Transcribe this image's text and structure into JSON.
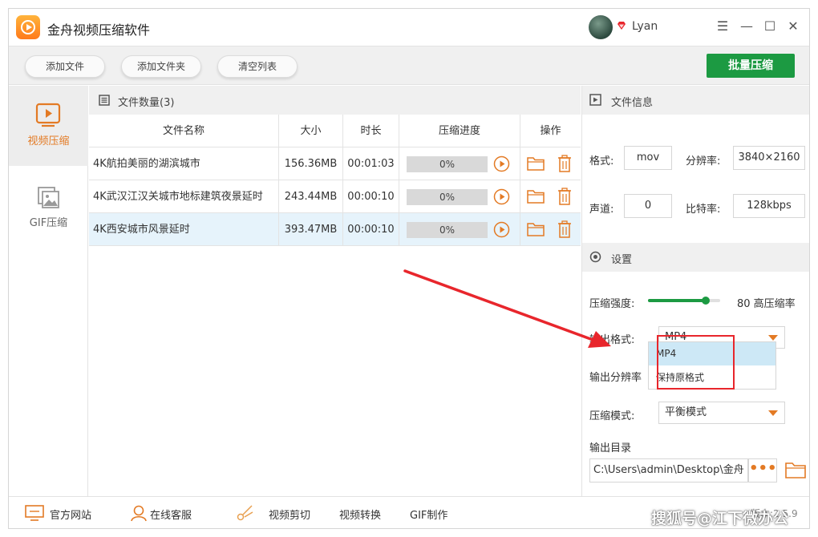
{
  "app": {
    "title": "金舟视频压缩软件",
    "user": "Lyan"
  },
  "window_controls": {
    "menu": "☰",
    "minimize": "—",
    "maximize": "☐",
    "close": "✕"
  },
  "toolbar": {
    "add_file": "添加文件",
    "add_folder": "添加文件夹",
    "clear_list": "清空列表",
    "batch_compress": "批量压缩"
  },
  "sidebar": {
    "items": [
      {
        "label": "视频压缩",
        "active": true
      },
      {
        "label": "GIF压缩",
        "active": false
      }
    ]
  },
  "file_list": {
    "count_label": "文件数量(3)",
    "columns": [
      "文件名称",
      "大小",
      "时长",
      "压缩进度",
      "操作"
    ],
    "rows": [
      {
        "name": "4K航拍美丽的湖滨城市",
        "size": "156.36MB",
        "duration": "00:01:03",
        "progress": "0%"
      },
      {
        "name": "4K武汉江汉关城市地标建筑夜景延时",
        "size": "243.44MB",
        "duration": "00:00:10",
        "progress": "0%"
      },
      {
        "name": "4K西安城市风景延时",
        "size": "393.47MB",
        "duration": "00:00:10",
        "progress": "0%"
      }
    ],
    "selected_row": 2
  },
  "file_info": {
    "title": "文件信息",
    "format_label": "格式:",
    "format_value": "mov",
    "resolution_label": "分辨率:",
    "resolution_value": "3840×2160",
    "channels_label": "声道:",
    "channels_value": "0",
    "bitrate_label": "比特率:",
    "bitrate_value": "128kbps"
  },
  "settings": {
    "title": "设置",
    "strength_label": "压缩强度:",
    "strength_value": 80,
    "strength_text": "80 高压缩率",
    "output_format_label": "输出格式:",
    "output_format_value": "MP4",
    "output_format_options": [
      "MP4",
      "保持原格式"
    ],
    "output_format_highlighted": 0,
    "output_resolution_label": "输出分辨率",
    "compress_mode_label": "压缩模式:",
    "compress_mode_value": "平衡模式",
    "output_dir_label": "输出目录",
    "output_dir_value": "C:\\Users\\admin\\Desktop\\金舟",
    "more_button": "•••"
  },
  "bottom_bar": {
    "website": "官方网站",
    "support": "在线客服",
    "video_cut": "视频剪切",
    "video_convert": "视频转换",
    "gif_make": "GIF制作",
    "version": "版本:2.5.9"
  },
  "watermark": "搜狐号@江下微办公",
  "colors": {
    "accent_green": "#1c9a42",
    "accent_orange": "#e37a24",
    "annotation_red": "#e8262c"
  }
}
